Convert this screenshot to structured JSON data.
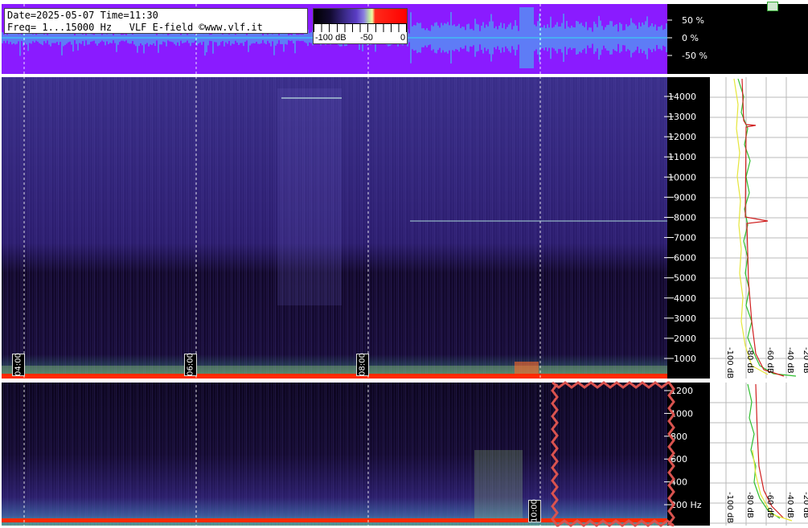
{
  "header": {
    "line1": "Date=2025-05-07 Time=11:30",
    "line2": "Freq= 1...15000 Hz   VLF E-field ©www.vlf.it"
  },
  "colorbar": {
    "labels": [
      "-100 dB",
      "-50",
      "0"
    ]
  },
  "waveform_axis": [
    "50 %",
    "0 %",
    "-50 %"
  ],
  "freq_axis_upper": [
    "14000",
    "13000",
    "12000",
    "11000",
    "10000",
    "9000",
    "8000",
    "7000",
    "6000",
    "5000",
    "4000",
    "3000",
    "2000",
    "1000"
  ],
  "freq_axis_lower": [
    "1200",
    "1000",
    "800",
    "600",
    "400",
    "200 Hz"
  ],
  "spectrum_axis_upper": [
    "-100 dB",
    "-80 dB",
    "-60 dB",
    "-40 dB",
    "-20 dB"
  ],
  "spectrum_axis_lower": [
    "-100 dB",
    "-80 dB",
    "-60 dB",
    "-40 dB",
    "-20 dB"
  ],
  "time_labels": [
    "04:00",
    "06:00",
    "08:00",
    "10:00"
  ],
  "colors": {
    "waveform_bg": "#8a1bff",
    "waveform_trace": "#33ddee",
    "spectrogram_bg": "#1a0a3a",
    "red_band": "#ff2a00",
    "annotation": "#d9534f"
  }
}
